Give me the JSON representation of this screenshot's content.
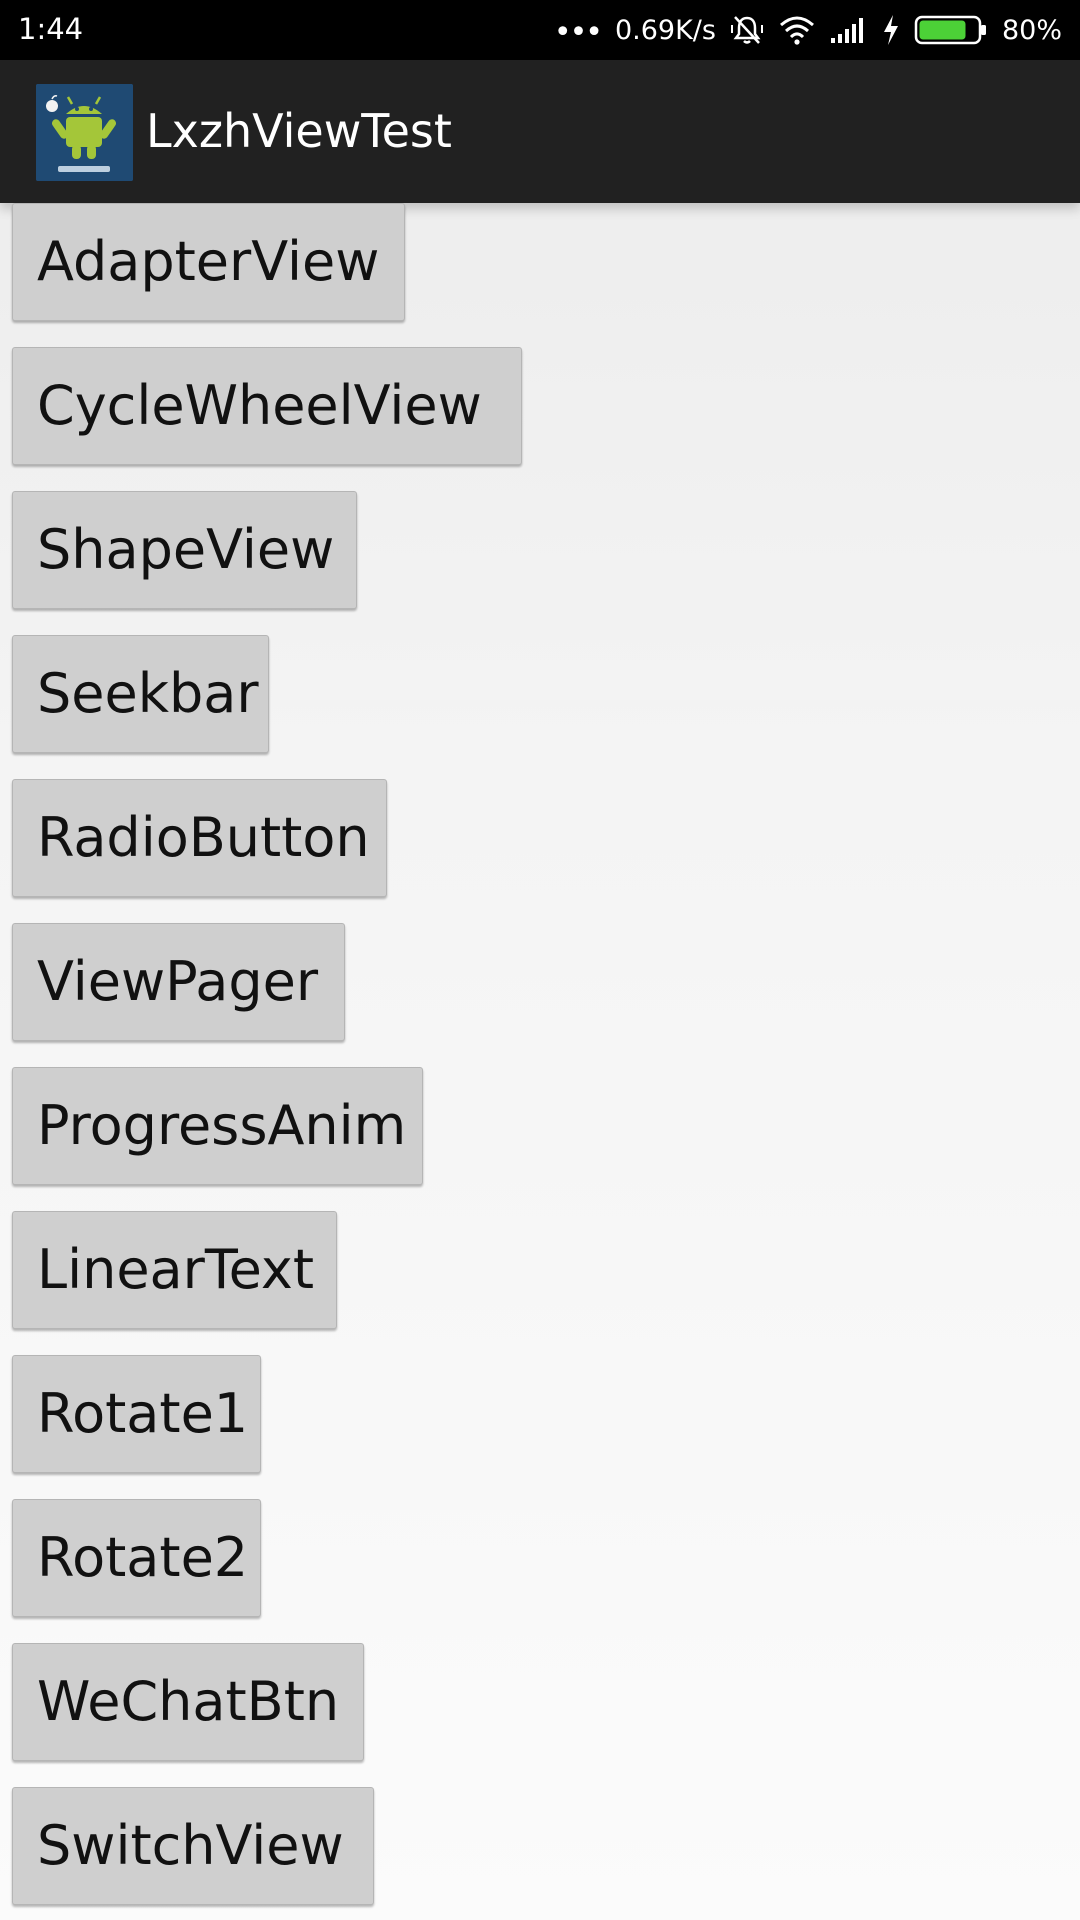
{
  "status_bar": {
    "time": "1:44",
    "dots": "•••",
    "network_speed": "0.69K/s",
    "battery_percent": "80%",
    "battery_level": 0.8,
    "battery_color": "#4cd137",
    "icons": [
      "silent-vibrate-icon",
      "wifi-icon",
      "signal-icon",
      "charging-bolt-icon",
      "battery-icon"
    ]
  },
  "action_bar": {
    "app_title": "LxzhViewTest",
    "icon": "android-launcher-icon",
    "icon_background": "#1f4a73",
    "android_green": "#a4c639"
  },
  "buttons": [
    {
      "label": "AdapterView"
    },
    {
      "label": "CycleWheelView"
    },
    {
      "label": "ShapeView"
    },
    {
      "label": "Seekbar"
    },
    {
      "label": "RadioButton"
    },
    {
      "label": "ViewPager"
    },
    {
      "label": "ProgressAnim"
    },
    {
      "label": "LinearText"
    },
    {
      "label": "Rotate1"
    },
    {
      "label": "Rotate2"
    },
    {
      "label": "WeChatBtn"
    },
    {
      "label": "SwitchView"
    }
  ]
}
